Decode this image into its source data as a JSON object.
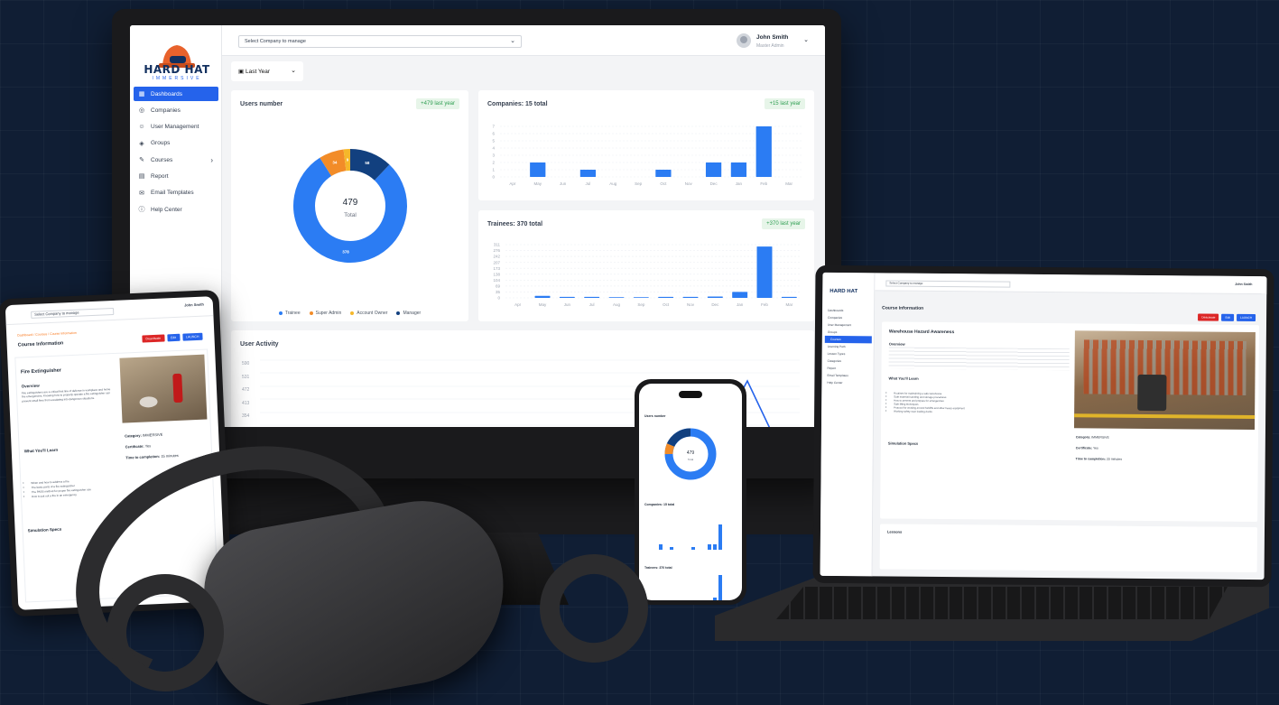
{
  "brand": {
    "name": "HARD HAT",
    "tagline": "IMMERSIVE"
  },
  "topbar": {
    "company_placeholder": "Select Company to manage",
    "user_name": "John Smith",
    "user_role": "Master Admin"
  },
  "period": "Last Year",
  "sidebar": {
    "items": [
      "Dashboards",
      "Companies",
      "User Management",
      "Groups",
      "Courses",
      "Report",
      "Email Templates",
      "Help Center"
    ]
  },
  "users_card": {
    "title": "Users number",
    "badge": "+479 last year",
    "total": "479",
    "total_label": "Total",
    "legend": [
      "Trainee",
      "Super Admin",
      "Account Owner",
      "Manager"
    ]
  },
  "companies_card": {
    "title": "Companies: 15 total",
    "badge": "+15 last year"
  },
  "trainees_card": {
    "title": "Trainees: 370 total",
    "badge": "+370 last year"
  },
  "activity_card": {
    "title": "User Activity",
    "ticks": [
      "590",
      "531",
      "472",
      "413",
      "354",
      "295"
    ]
  },
  "colors": {
    "trainee": "#2b7cf3",
    "super_admin": "#f28c28",
    "account_owner": "#f5b72a",
    "manager": "#12407f",
    "badge_bg": "#e7f5e9",
    "badge_fg": "#2f9e52",
    "primary": "#2563eb",
    "danger": "#dc2626"
  },
  "chart_data": [
    {
      "type": "pie",
      "title": "Users number",
      "categories": [
        "Trainee",
        "Super Admin",
        "Account Owner",
        "Manager"
      ],
      "values": [
        378,
        34,
        9,
        58
      ]
    },
    {
      "type": "bar",
      "title": "Companies: 15 total",
      "categories": [
        "Apr",
        "May",
        "Jun",
        "Jul",
        "Aug",
        "Sep",
        "Oct",
        "Nov",
        "Dec",
        "Jan",
        "Feb",
        "Mar"
      ],
      "values": [
        0,
        2,
        0,
        1,
        0,
        0,
        1,
        0,
        2,
        2,
        7,
        0
      ],
      "ylim": [
        0,
        7
      ],
      "yticks": [
        "0",
        "1",
        "2",
        "3",
        "4",
        "5",
        "6",
        "7"
      ]
    },
    {
      "type": "bar",
      "title": "Trainees: 370 total",
      "categories": [
        "Apr",
        "May",
        "Jun",
        "Jul",
        "Aug",
        "Sep",
        "Oct",
        "Nov",
        "Dec",
        "Jan",
        "Feb",
        "Mar"
      ],
      "values": [
        0,
        12,
        6,
        6,
        4,
        4,
        6,
        6,
        8,
        35,
        300,
        6
      ],
      "ylim": [
        0,
        311
      ],
      "yticks": [
        "0",
        "35",
        "69",
        "104",
        "138",
        "173",
        "207",
        "242",
        "276",
        "311"
      ]
    }
  ],
  "tablet": {
    "breadcrumb": "Dashboard / Courses / Course Information",
    "page_title": "Course Information",
    "buttons": [
      "Deactivate",
      "Edit",
      "LAUNCH"
    ],
    "course_title": "Fire Extinguisher",
    "overview_heading": "Overview",
    "overview_text": "Fire extinguishers are a critical first line of defense in workplace and home fire emergencies. Knowing how to properly operate a fire extinguisher can prevent small fires from escalating into dangerous situations.",
    "learn_heading": "What You'll Learn",
    "learn_items": [
      "When and how to address a fire",
      "The basic parts of a fire extinguisher",
      "The PASS method for proper fire extinguisher use",
      "How to put out a fire in an emergency"
    ],
    "specs_heading": "Simulation Specs",
    "category_label": "Category:",
    "category_value": "IMMERSIVE",
    "certificate_label": "Certificate:",
    "certificate_value": "Yes",
    "time_label": "Time to completion:",
    "time_value": "15 minutes"
  },
  "laptop": {
    "page_title": "Course Information",
    "buttons": [
      "Deactivate",
      "Edit",
      "LAUNCH"
    ],
    "course_title": "Warehouse Hazard Awareness",
    "overview_heading": "Overview",
    "learn_heading": "What You'll Learn",
    "learn_items": [
      "Routines for maintaining a safe warehouse",
      "Safe material handling and storage procedures",
      "How to prevent and prepare for emergencies",
      "Safe lifting techniques",
      "Protocol for working around forklifts and other heavy equipment",
      "Working safety near loading docks"
    ],
    "specs_heading": "Simulation Specs",
    "category_value": "IMMERSIVE",
    "certificate_value": "Yes",
    "time_value": "20 minutes",
    "lessons_heading": "Lessons",
    "sidebar_items": [
      "Dashboards",
      "Companies",
      "User Management",
      "Groups",
      "Courses",
      "Learning Path",
      "Lesson Types",
      "Categories",
      "Report",
      "Email Templates",
      "Help Center"
    ]
  },
  "phone": {
    "users_title": "Users number",
    "total": "479",
    "total_label": "Total",
    "companies_title": "Companies: 15 total",
    "trainees_title": "Trainees: 370 total"
  }
}
